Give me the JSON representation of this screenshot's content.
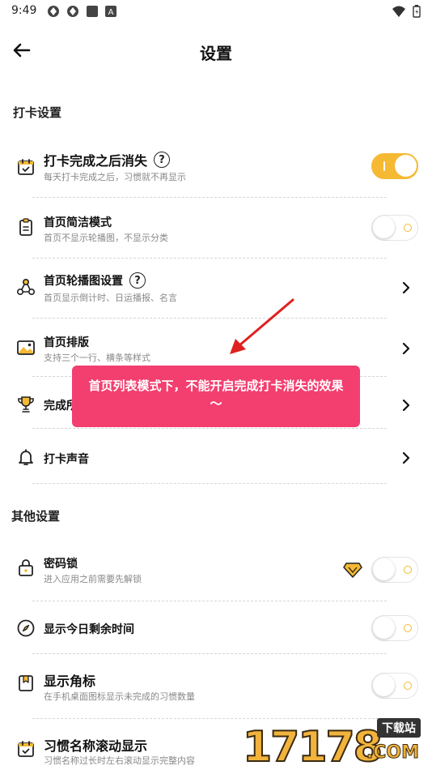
{
  "status_bar": {
    "time": "9:49",
    "left_icons": [
      "aperture-icon",
      "aperture-icon",
      "square-icon",
      "a-badge-icon"
    ],
    "right_icons": [
      "wifi-icon",
      "battery-icon"
    ]
  },
  "header": {
    "title": "设置",
    "back_icon": "arrow-left-icon"
  },
  "sections": {
    "checkin": {
      "title": "打卡设置",
      "items": [
        {
          "title": "打卡完成之后消失",
          "subtitle": "每天打卡完成之后，习惯就不再显示",
          "icon": "calendar-check-icon",
          "control": "toggle",
          "on": true,
          "help": true
        },
        {
          "title": "首页简洁模式",
          "subtitle": "首页不显示轮播图，不显示分类",
          "icon": "clipboard-icon",
          "control": "toggle",
          "on": false
        },
        {
          "title": "首页轮播图设置",
          "subtitle": "首页显示倒计时、日运播报、名言",
          "icon": "nodes-icon",
          "control": "chevron",
          "help": true
        },
        {
          "title": "首页排版",
          "subtitle": "支持三个一行、横条等样式",
          "icon": "image-icon",
          "control": "chevron"
        },
        {
          "title": "完成所",
          "subtitle": "",
          "icon": "trophy-icon",
          "control": "chevron"
        },
        {
          "title": "打卡声音",
          "subtitle": "",
          "icon": "bell-icon",
          "control": "chevron"
        }
      ]
    },
    "other": {
      "title": "其他设置",
      "items": [
        {
          "title": "密码锁",
          "subtitle": "进入应用之前需要先解锁",
          "icon": "lock-icon",
          "control": "toggle",
          "on": false,
          "premium": true
        },
        {
          "title": "显示今日剩余时间",
          "subtitle": "",
          "icon": "compass-icon",
          "control": "toggle",
          "on": false
        },
        {
          "title": "显示角标",
          "subtitle": "在手机桌面图标显示未完成的习惯数量",
          "icon": "bookmark-icon",
          "control": "toggle",
          "on": false
        },
        {
          "title": "习惯名称滚动显示",
          "subtitle": "习惯名称过长时左右滚动显示完整内容",
          "icon": "calendar-check-icon",
          "control": "toggle",
          "on": false
        }
      ]
    }
  },
  "toast": {
    "text": "首页列表模式下，不能开启完成打卡消失的效果～"
  },
  "watermark": {
    "digits": "17178",
    "badge": "下载站",
    "suffix": ".COM"
  },
  "colors": {
    "accent": "#f5b933",
    "toast": "#f23f6f",
    "arrow": "#e02020"
  }
}
